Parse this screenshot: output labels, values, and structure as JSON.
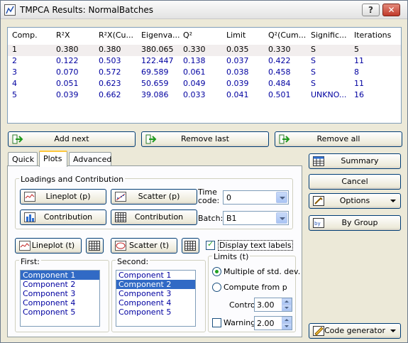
{
  "window": {
    "title": "TMPCA Results: NormalBatches",
    "help": "?",
    "close": "✕"
  },
  "grid": {
    "headers": [
      "Comp.",
      "R²X",
      "R²X(Cu...",
      "Eigenva...",
      "Q²",
      "Limit",
      "Q²(Cum...",
      "Signific...",
      "Iterations"
    ],
    "rows": [
      [
        "1",
        "0.380",
        "0.380",
        "380.065",
        "0.330",
        "0.035",
        "0.330",
        "S",
        "5"
      ],
      [
        "2",
        "0.122",
        "0.503",
        "122.447",
        "0.138",
        "0.037",
        "0.422",
        "S",
        "11"
      ],
      [
        "3",
        "0.070",
        "0.572",
        "69.589",
        "0.061",
        "0.038",
        "0.458",
        "S",
        "8"
      ],
      [
        "4",
        "0.051",
        "0.623",
        "50.659",
        "0.049",
        "0.039",
        "0.484",
        "S",
        "11"
      ],
      [
        "5",
        "0.039",
        "0.662",
        "39.086",
        "0.033",
        "0.041",
        "0.501",
        "UNKNO...",
        "16"
      ]
    ]
  },
  "actions": {
    "add_next": "Add next",
    "remove_last": "Remove last",
    "remove_all": "Remove all"
  },
  "tabs": [
    "Quick",
    "Plots",
    "Advanced"
  ],
  "loadings": {
    "title": "Loadings and Contribution",
    "lineplot_p": "Lineplot (p)",
    "scatter_p": "Scatter (p)",
    "contribution1": "Contribution",
    "contribution2": "Contribution",
    "time_code_label": "Time code:",
    "time_code_value": "0",
    "batch_label": "Batch:",
    "batch_value": "B1"
  },
  "plots": {
    "lineplot_t": "Lineplot (t)",
    "scatter_t": "Scatter (t)",
    "display_text_labels": "Display text labels",
    "display_text_labels_checked": true
  },
  "first": {
    "label": "First:",
    "items": [
      "Component 1",
      "Component 2",
      "Component 3",
      "Component 4",
      "Component 5"
    ],
    "selected": 0
  },
  "second": {
    "label": "Second:",
    "items": [
      "Component 1",
      "Component 2",
      "Component 3",
      "Component 4",
      "Component 5"
    ],
    "selected": 1
  },
  "limits": {
    "title": "Limits (t)",
    "multiple": "Multiple of std. dev.",
    "compute": "Compute from p",
    "control_label": "Control",
    "control_value": "3.00",
    "warning_label": "Warning",
    "warning_value": "2.00",
    "warning_checked": false
  },
  "side": {
    "summary": "Summary",
    "cancel": "Cancel",
    "options": "Options",
    "by_group": "By Group",
    "code_generator": "Code generator"
  }
}
